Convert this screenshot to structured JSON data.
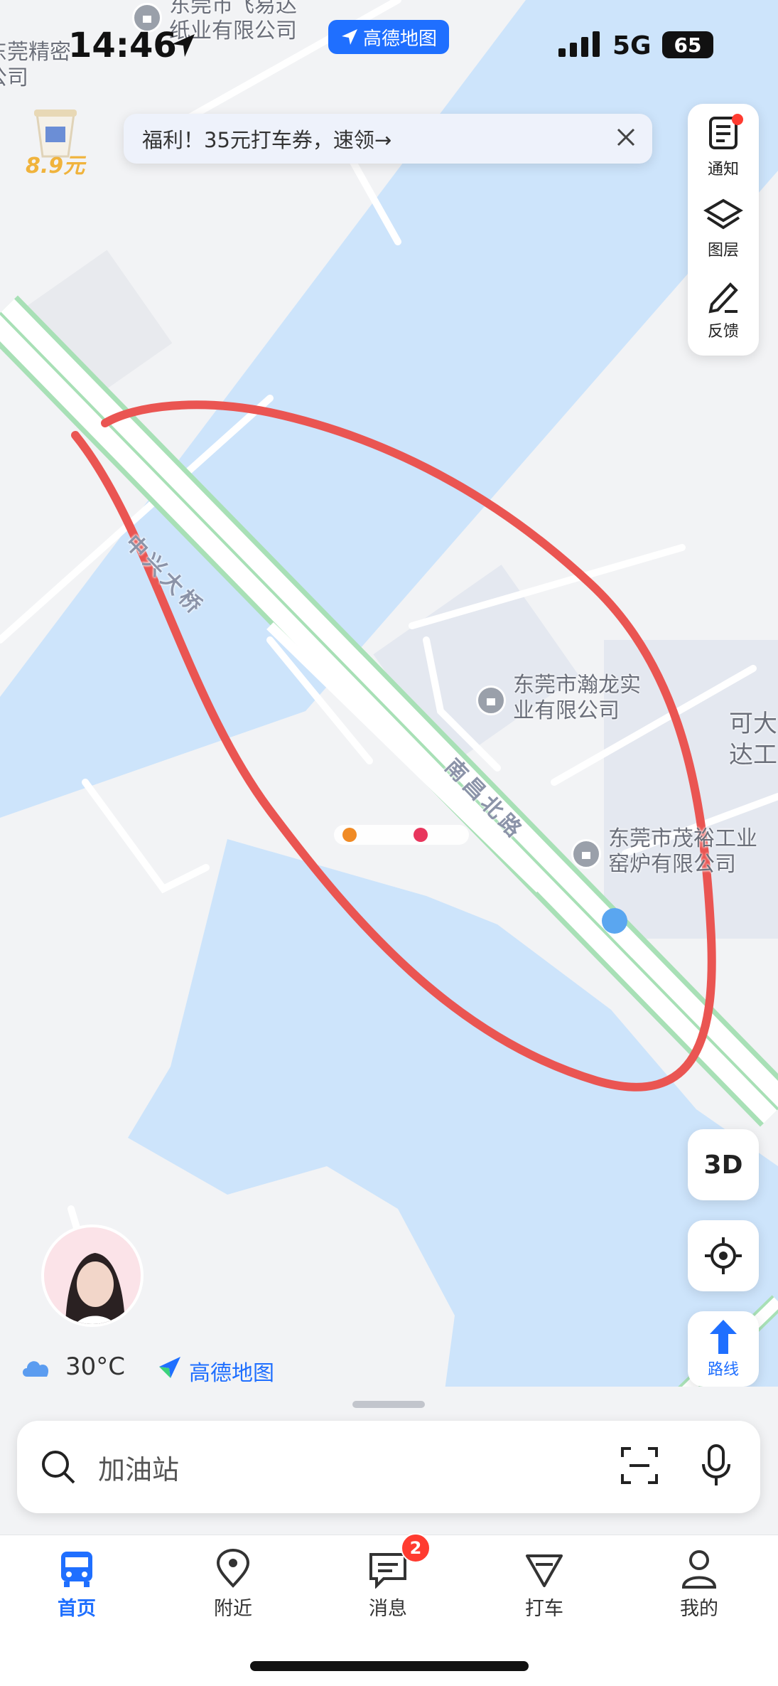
{
  "status_bar": {
    "time": "14:46",
    "network": "5G",
    "battery": "65",
    "app_badge": "高德地图"
  },
  "promo": {
    "price": "8.9元",
    "banner_text": "福利！35元打车券，速领→"
  },
  "right_panel": {
    "notify": "通知",
    "layers": "图层",
    "feedback": "反馈"
  },
  "map": {
    "poi_top_1": "东莞市飞易达",
    "poi_top_2": "纸业有限公司",
    "poi_left_1": "东莞精密",
    "poi_left_2": "公司",
    "poi_hanlong_1": "东莞市瀚龙实",
    "poi_hanlong_2": "业有限公司",
    "poi_maoyu_1": "东莞市茂裕工业",
    "poi_maoyu_2": "窑炉有限公司",
    "poi_right_1": "可大",
    "poi_right_2": "达工",
    "road_bridge": "中兴大桥",
    "road_nanchang": "南昌北路"
  },
  "map_controls": {
    "btn_3d": "3D",
    "route": "路线"
  },
  "weather": {
    "temp": "30°C",
    "brand": "高德地图"
  },
  "search": {
    "placeholder": "加油站"
  },
  "tabs": [
    {
      "label": "首页",
      "active": true
    },
    {
      "label": "附近",
      "active": false
    },
    {
      "label": "消息",
      "active": false,
      "badge": "2"
    },
    {
      "label": "打车",
      "active": false
    },
    {
      "label": "我的",
      "active": false
    }
  ],
  "colors": {
    "accent": "#1f6fff",
    "water": "#cde4fb",
    "land": "#f2f3f5",
    "road_green": "#a8e0b6",
    "annotation": "#ea5552",
    "badge_red": "#ff3b30"
  }
}
